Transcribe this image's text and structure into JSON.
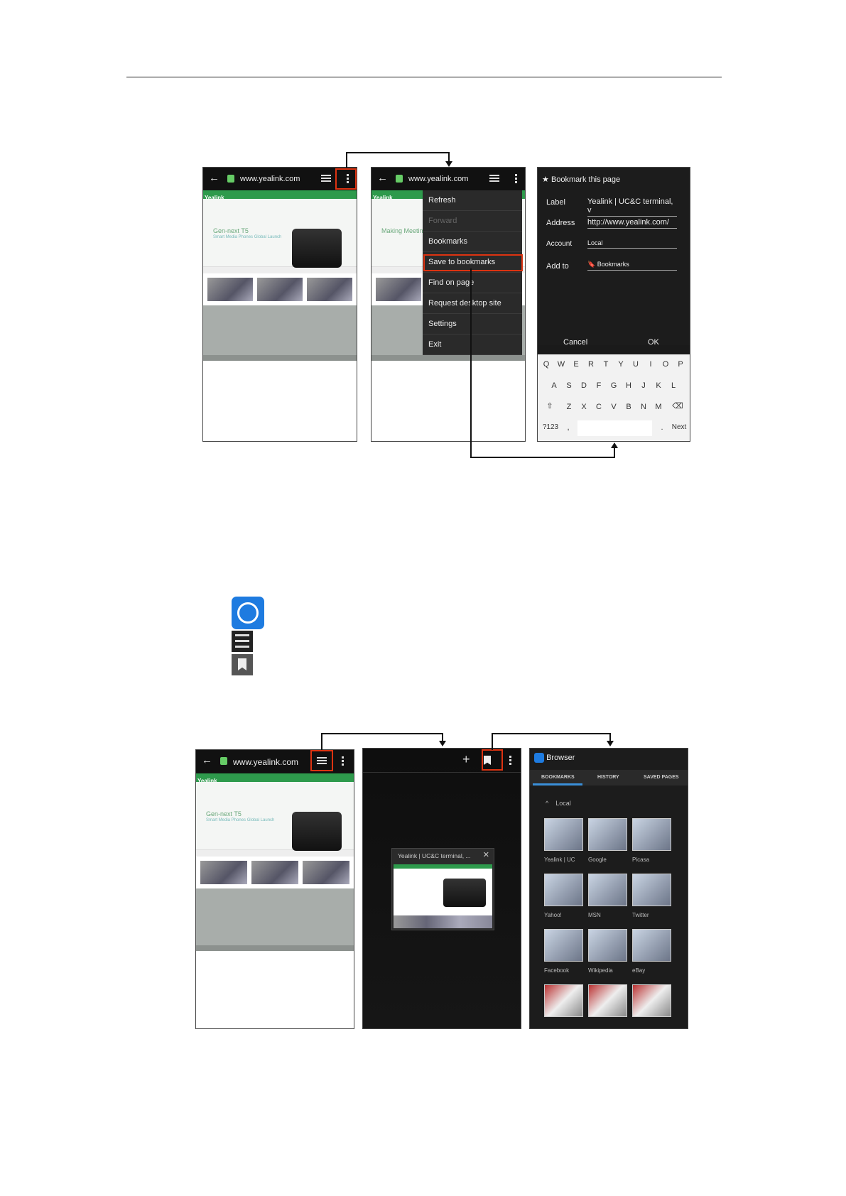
{
  "top_figure": {
    "url": "www.yealink.com",
    "site_brand": "Yealink",
    "hero_title": "Gen-next T5",
    "hero_sub": "Smart Media Phones Global Launch",
    "hero_title2": "Making Meeting S",
    "menu": [
      "Refresh",
      "Forward",
      "Bookmarks",
      "Save to bookmarks",
      "Find on page",
      "Request desktop site",
      "Settings",
      "Exit"
    ],
    "dialog": {
      "title": "Bookmark this page",
      "label_label": "Label",
      "label_value": "Yealink | UC&C terminal, v",
      "address_label": "Address",
      "address_value": "http://www.yealink.com/",
      "account_label": "Account",
      "account_value": "Local",
      "addto_label": "Add to",
      "addto_value": "Bookmarks",
      "cancel": "Cancel",
      "ok": "OK"
    },
    "keyboard": {
      "row1": [
        "Q",
        "W",
        "E",
        "R",
        "T",
        "Y",
        "U",
        "I",
        "O",
        "P"
      ],
      "row2": [
        "A",
        "S",
        "D",
        "F",
        "G",
        "H",
        "J",
        "K",
        "L"
      ],
      "row3": [
        "Z",
        "X",
        "C",
        "V",
        "B",
        "N",
        "M"
      ],
      "sym": "?123",
      "comma": ",",
      "dot": ".",
      "next": "Next"
    }
  },
  "bottom_figure": {
    "url": "www.yealink.com",
    "tab_title": "Yealink | UC&C terminal, ...",
    "browser_title": "Browser",
    "tabs": [
      "BOOKMARKS",
      "HISTORY",
      "SAVED PAGES"
    ],
    "folder": "Local",
    "bookmarks": [
      "Yealink | UC",
      "Google",
      "Picasa",
      "Yahoo!",
      "MSN",
      "Twitter",
      "Facebook",
      "Wikipedia",
      "eBay"
    ]
  }
}
